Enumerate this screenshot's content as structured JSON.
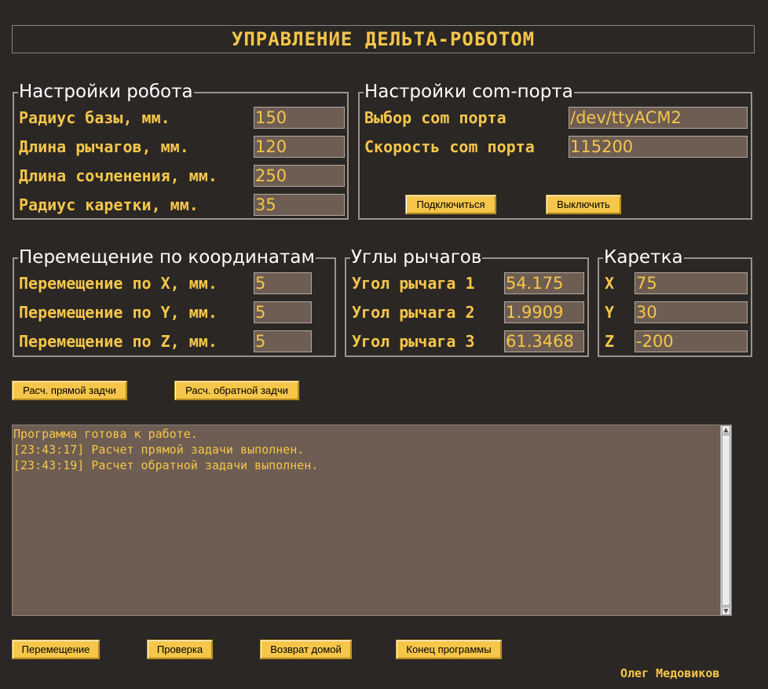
{
  "header": {
    "title": "УПРАВЛЕНИЕ ДЕЛЬТА-РОБОТОМ"
  },
  "robot_settings": {
    "title": "Настройки робота",
    "rows": [
      {
        "label": "Радиус базы, мм.",
        "value": "150"
      },
      {
        "label": "Длина рычагов, мм.",
        "value": "120"
      },
      {
        "label": "Длина сочленения, мм.",
        "value": "250"
      },
      {
        "label": "Радиус каретки, мм.",
        "value": "35"
      }
    ]
  },
  "com_settings": {
    "title": "Настройки com-порта",
    "rows": [
      {
        "label": "Выбор com порта",
        "value": "/dev/ttyACM2"
      },
      {
        "label": "Скорость com порта",
        "value": "115200"
      }
    ],
    "connect_label": "Подключиться",
    "disconnect_label": "Выключить"
  },
  "movement": {
    "title": "Перемещение по координатам",
    "rows": [
      {
        "label": "Перемещение по X, мм.",
        "value": "5"
      },
      {
        "label": "Перемещение по Y, мм.",
        "value": "5"
      },
      {
        "label": "Перемещение по Z, мм.",
        "value": "5"
      }
    ]
  },
  "lever_angles": {
    "title": "Углы рычагов",
    "rows": [
      {
        "label": "Угол рычага 1",
        "value": "54.175"
      },
      {
        "label": "Угол рычага 2",
        "value": "1.9909"
      },
      {
        "label": "Угол рычага 3",
        "value": "61.3468"
      }
    ]
  },
  "carriage": {
    "title": "Каретка",
    "rows": [
      {
        "label": "X",
        "value": "75"
      },
      {
        "label": "Y",
        "value": "30"
      },
      {
        "label": "Z",
        "value": "-200"
      }
    ]
  },
  "calc_buttons": {
    "forward": "Расч. прямой задчи",
    "inverse": "Расч. обратной задчи"
  },
  "log": {
    "lines": [
      "Программа готова к работе.",
      "[23:43:17] Расчет прямой задачи выполнен.",
      "[23:43:19] Расчет обратной задачи выполнен."
    ],
    "scroll_up_icon": "arrow-up-icon",
    "scroll_down_icon": "arrow-down-icon"
  },
  "bottom_buttons": {
    "move": "Перемещение",
    "check": "Проверка",
    "home": "Возврат домой",
    "exit": "Конец программы"
  },
  "footer": {
    "author": "Олег Медовиков"
  },
  "colors": {
    "background": "#2b2724",
    "accent": "#f5c64a",
    "field_bg": "#6e5d52",
    "group_border": "#9a948f"
  }
}
